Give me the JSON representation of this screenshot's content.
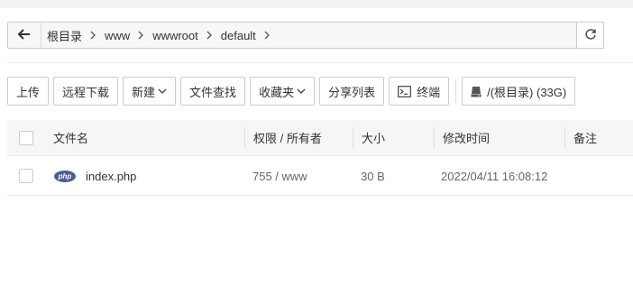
{
  "path": {
    "crumbs": [
      "根目录",
      "www",
      "wwwroot",
      "default"
    ]
  },
  "toolbar": {
    "upload": "上传",
    "remote_download": "远程下载",
    "new": "新建",
    "file_search": "文件查找",
    "favorites": "收藏夹",
    "share_list": "分享列表",
    "terminal": "终端",
    "disk": "/(根目录) (33G)"
  },
  "table": {
    "headers": {
      "name": "文件名",
      "permission": "权限 / 所有者",
      "size": "大小",
      "modified": "修改时间",
      "note": "备注"
    },
    "rows": [
      {
        "icon_label": "php",
        "name": "index.php",
        "permission": "755 / www",
        "size": "30 B",
        "modified": "2022/04/11 16:08:12",
        "note": ""
      }
    ]
  },
  "colors": {
    "php_icon": "#4f5b93",
    "border": "#cccccc",
    "header_bg": "#f6f6f6"
  }
}
